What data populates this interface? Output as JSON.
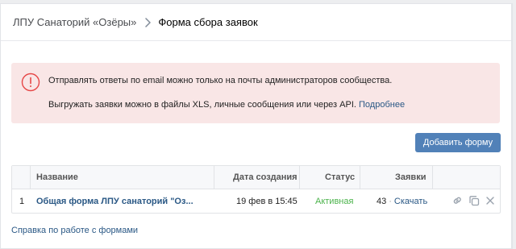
{
  "breadcrumb": {
    "parent": "ЛПУ Санаторий «Озёры»",
    "current": "Форма сбора заявок"
  },
  "alert": {
    "line1": "Отправлять ответы по email можно только на почты администраторов сообщества.",
    "line2_text": "Выгружать заявки можно в файлы XLS, личные сообщения или через API.",
    "line2_link": "Подробнее",
    "color": "#f9e6e6",
    "icon_color": "#e64646"
  },
  "add_button": {
    "label": "Добавить форму",
    "color": "#5181b8"
  },
  "table": {
    "columns": {
      "name": "Название",
      "date": "Дата создания",
      "status": "Статус",
      "requests": "Заявки"
    },
    "rows": [
      {
        "index": "1",
        "name": "Общая форма ЛПУ санаторий \"Оз...",
        "date": "19 фев в 15:45",
        "status": "Активная",
        "count": "43",
        "download": "Скачать"
      }
    ],
    "actions": [
      "link-icon",
      "copy-icon",
      "close-icon"
    ]
  },
  "help_link": "Справка по работе с формами"
}
